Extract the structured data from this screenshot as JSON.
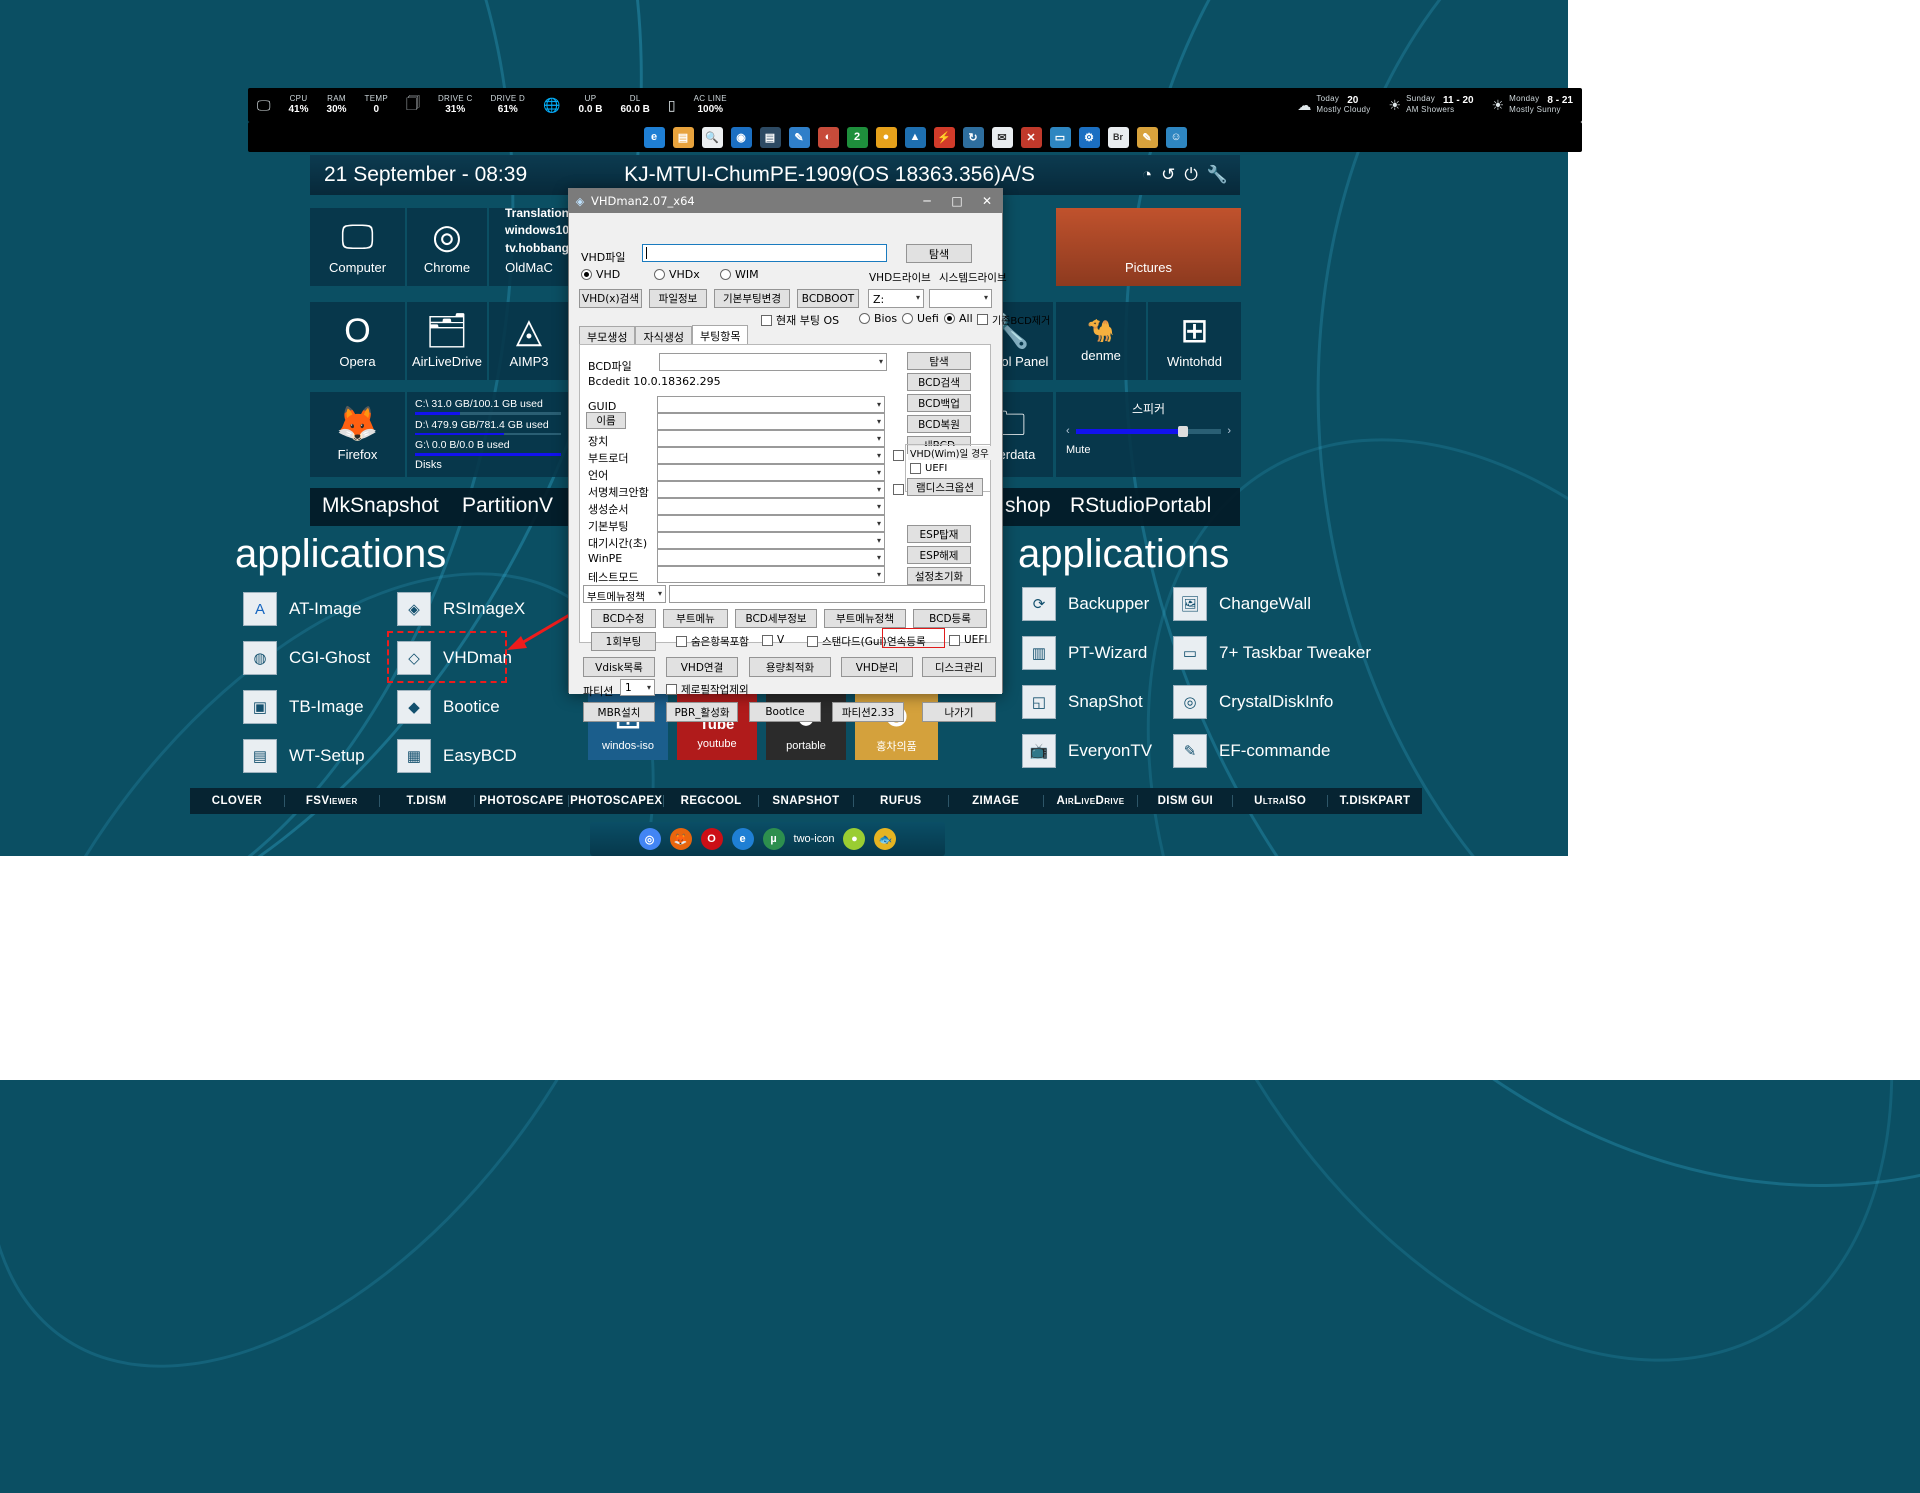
{
  "desktop": {
    "sysbar": [
      {
        "icon": "monitor-icon",
        "label": "",
        "value": ""
      },
      {
        "label": "CPU",
        "value": "41%"
      },
      {
        "label": "RAM",
        "value": "30%"
      },
      {
        "label": "TEMP",
        "value": "0"
      },
      {
        "icon": "battery-icon"
      },
      {
        "label": "DRIVE C",
        "value": "31%"
      },
      {
        "label": "DRIVE D",
        "value": "61%"
      },
      {
        "icon": "globe-icon"
      },
      {
        "label": "UP",
        "value": "0.0 B"
      },
      {
        "label": "DL",
        "value": "60.0 B"
      },
      {
        "icon": "phone-icon"
      },
      {
        "label": "AC LINE",
        "value": "100%"
      }
    ],
    "weather": [
      {
        "icon": "cloud-icon",
        "day": "Today",
        "temp": "20",
        "desc": "Mostly Cloudy"
      },
      {
        "icon": "sun-icon",
        "day": "Sunday",
        "temp": "11 - 20",
        "desc": "AM Showers"
      },
      {
        "icon": "sun-icon",
        "day": "Monday",
        "temp": "8 - 21",
        "desc": "Mostly Sunny"
      }
    ],
    "dock_icons": [
      "edge-icon",
      "folder-icon",
      "search-icon",
      "opera-icon",
      "film-icon",
      "wrench-icon",
      "camera-icon",
      "two-icon",
      "record-icon",
      "warning-icon",
      "flash-icon",
      "sync-icon",
      "mail-icon",
      "close-icon",
      "monitor-icon",
      "gear-icon",
      "br-icon",
      "brush-icon",
      "user-icon"
    ],
    "header": {
      "date": "21 September - 08:39",
      "title": "KJ-MTUI-ChumPE-1909(OS 18363.356)A/S",
      "icons": [
        "info-icon",
        "refresh-icon",
        "power-icon",
        "wrench-icon"
      ]
    },
    "tiles": [
      {
        "name": "Computer",
        "icon": "computer-icon"
      },
      {
        "name": "Chrome",
        "icon": "chrome-icon"
      },
      {
        "name": "OldMaC",
        "icon": "oldmac-icon"
      },
      {
        "name": "Pictures",
        "icon": "pictures-icon"
      },
      {
        "name": "Opera",
        "icon": "opera-icon"
      },
      {
        "name": "AirLiveDrive",
        "icon": "airlivedrive-icon"
      },
      {
        "name": "AIMP3",
        "icon": "aimp3-icon"
      },
      {
        "name": "Control Panel",
        "icon": "controlpanel-icon"
      },
      {
        "name": "denme",
        "icon": "camel-icon"
      },
      {
        "name": "Wintohdd",
        "icon": "windows-icon"
      },
      {
        "name": "Firefox",
        "icon": "firefox-icon"
      },
      {
        "name": "Disks",
        "icon": "disks-icon"
      },
      {
        "name": "Userdata",
        "icon": "userdata-icon"
      }
    ],
    "translation": [
      "Translation",
      "windows10",
      "tv.hobbang"
    ],
    "disks": [
      {
        "text": "C:\\  31.0 GB/100.1 GB used",
        "pct": 31
      },
      {
        "text": "D:\\ 479.9 GB/781.4 GB used",
        "pct": 61
      },
      {
        "text": "G:\\ 0.0 B/0.0 B used",
        "pct": 100
      }
    ],
    "speaker": {
      "label": "스피커",
      "mute": "Mute",
      "volume": 72
    },
    "bigwords": [
      "applications",
      "applications"
    ],
    "midrow": [
      "MkSnapshot",
      "PartitionV",
      "shop",
      "RStudioPortabl"
    ],
    "apps_left": [
      {
        "label": "AT-Image",
        "icon": "a-icon"
      },
      {
        "label": "CGI-Ghost",
        "icon": "ghost-icon"
      },
      {
        "label": "TB-Image",
        "icon": "tb-icon"
      },
      {
        "label": "WT-Setup",
        "icon": "wt-icon"
      }
    ],
    "apps_mid": [
      {
        "label": "RSImageX",
        "icon": "rs-icon"
      },
      {
        "label": "VHDman",
        "icon": "vhd-icon"
      },
      {
        "label": "Bootice",
        "icon": "bootice-icon"
      },
      {
        "label": "EasyBCD",
        "icon": "easybcd-icon"
      }
    ],
    "apps_right1": [
      {
        "label": "Backupper",
        "icon": "backup-icon"
      },
      {
        "label": "PT-Wizard",
        "icon": "pt-icon"
      },
      {
        "label": "SnapShot",
        "icon": "snap-icon"
      },
      {
        "label": "EveryonTV",
        "icon": "tv-icon"
      }
    ],
    "apps_right2": [
      {
        "label": "ChangeWall",
        "icon": "wall-icon"
      },
      {
        "label": "7+ Taskbar Tweaker",
        "icon": "taskbar-icon"
      },
      {
        "label": "CrystalDiskInfo",
        "icon": "disk-icon"
      },
      {
        "label": "EF-commande",
        "icon": "ef-icon"
      }
    ],
    "thumbs": [
      {
        "label": "windos-iso",
        "icon": "windows-icon"
      },
      {
        "label": "youtube",
        "icon": "youtube-icon"
      },
      {
        "label": "portable",
        "icon": "portable-icon"
      },
      {
        "label": "홍차의품",
        "icon": "person-icon"
      }
    ],
    "tabstrip": [
      "CLOVER",
      "FSViewer",
      "T.DISM",
      "PHOTOSCAPE",
      "PHOTOSCAPEX",
      "REGCOOL",
      "SNAPSHOT",
      "RUFUS",
      "ZIMAGE",
      "AirLiveDrive",
      "DISM GUI",
      "UltraISO",
      "T.DISKPART"
    ],
    "taskbar_icons": [
      "chrome-icon",
      "firefox-icon",
      "opera-icon",
      "edge-icon",
      "utorrent-icon",
      "two-icon",
      "green-icon",
      "fish-icon"
    ]
  },
  "dialog": {
    "title": "VHDman2.07_x64",
    "title_icon": "vhd-icon",
    "window_buttons": {
      "minimize": "─",
      "maximize": "□",
      "close": "✕"
    },
    "vhd_file_label": "VHD파일",
    "vhd_file_value": "",
    "browse_top": "탐색",
    "format_radios": [
      {
        "label": "VHD",
        "checked": true
      },
      {
        "label": "VHDx",
        "checked": false
      },
      {
        "label": "WIM",
        "checked": false
      }
    ],
    "row_buttons": [
      "VHD(x)검색",
      "파일정보",
      "기본부팅변경",
      "BCDBOOT"
    ],
    "vhd_drive_label": "VHD드라이브",
    "system_drive_label": "시스템드라이브",
    "drive_letter": "Z:",
    "system_drive_value": "",
    "current_boot_os": "현재 부팅 OS",
    "firmware_radios": [
      {
        "label": "Bios",
        "checked": false
      },
      {
        "label": "Uefi",
        "checked": false
      },
      {
        "label": "All",
        "checked": true
      }
    ],
    "remove_existing_bcd": "기존BCD제거",
    "tabs": [
      {
        "label": "부모생성",
        "selected": false
      },
      {
        "label": "자식생성",
        "selected": false
      },
      {
        "label": "부팅항목",
        "selected": true
      }
    ],
    "bcd_file_label": "BCD파일",
    "bcd_file_value": "",
    "bcdedit_version": "Bcdedit 10.0.18362.295",
    "right_buttons": [
      "탐색",
      "BCD검색",
      "BCD백업",
      "BCD복원",
      "새BCD"
    ],
    "fields": [
      {
        "label": "GUID",
        "value": "",
        "type": "combo"
      },
      {
        "label": "이름",
        "value": "",
        "type": "combo",
        "label_is_button": true
      },
      {
        "label": "장치",
        "value": "",
        "type": "combo"
      },
      {
        "label": "부트로더",
        "value": "",
        "type": "combo"
      },
      {
        "label": "언어",
        "value": "",
        "type": "combo"
      },
      {
        "label": "서명체크안함",
        "value": "",
        "type": "combo"
      },
      {
        "label": "생성순서",
        "value": "",
        "type": "combo"
      },
      {
        "label": "기본부팅",
        "value": "",
        "type": "combo"
      },
      {
        "label": "대기시간(초)",
        "value": "",
        "type": "combo"
      },
      {
        "label": "WinPE",
        "value": "",
        "type": "combo"
      },
      {
        "label": "테스트모드",
        "value": "",
        "type": "combo"
      }
    ],
    "wim_group_title": "VHD(Wim)일 경우",
    "uefi_check_1": "UEFI",
    "ramdisk_button": "램디스크옵션",
    "esp_buttons": [
      "ESP탑재",
      "ESP해제",
      "설정초기화"
    ],
    "boot_menu_policy": "부트메뉴정책",
    "boot_menu_policy_value": "",
    "action_row_1": [
      "BCD수정",
      "부트메뉴",
      "BCD세부정보",
      "부트메뉴정책",
      "BCD등록"
    ],
    "once_boot": "1회부팅",
    "include_hidden": "숨은항목포함",
    "v_check": "V",
    "standard_gui": "스탠다드(Gui)",
    "continuous_reg": "연속등록",
    "uefi_check_2": "UEFI",
    "action_row_2": [
      "Vdisk목록",
      "VHD연결",
      "용량최적화",
      "VHD분리",
      "디스크관리"
    ],
    "partition_label": "파티션",
    "partition_value": "1",
    "zero_fill": "제로필작업제외",
    "action_row_3": [
      "MBR설치",
      "PBR_활성화",
      "Bootlce",
      "파티션2.33",
      "나가기"
    ]
  }
}
